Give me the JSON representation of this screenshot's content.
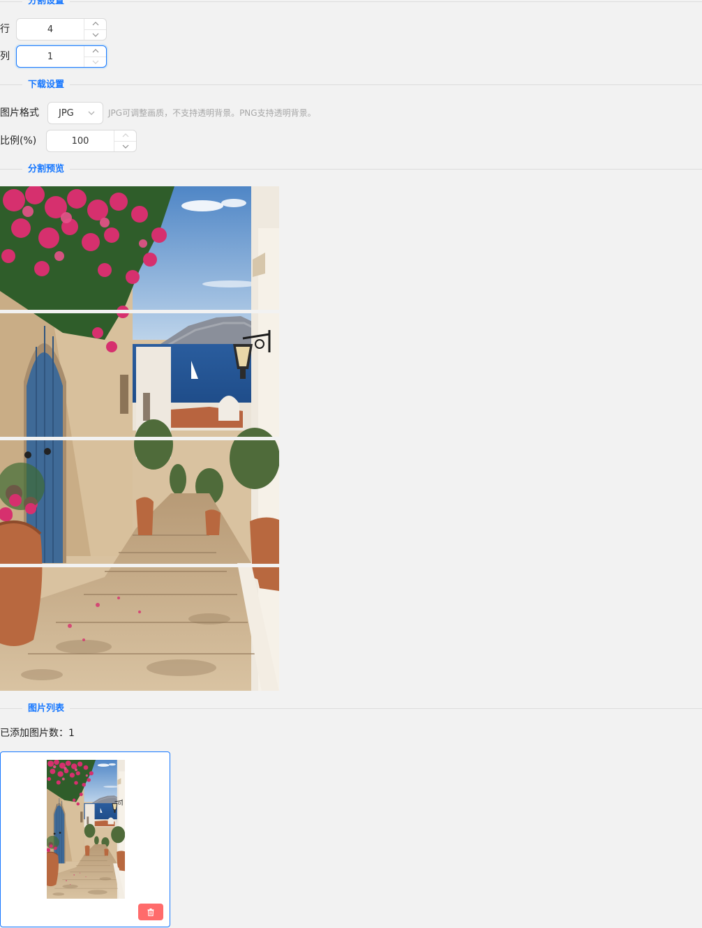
{
  "split_settings": {
    "section_title": "分割设置",
    "rows_label": "行",
    "rows_value": "4",
    "cols_label": "列",
    "cols_value": "1"
  },
  "download_settings": {
    "section_title": "下载设置",
    "format_label": "图片格式",
    "format_value": "JPG",
    "format_hint": "JPG可调整画质，不支持透明背景。PNG支持透明背景。",
    "scale_label": "比例(%)",
    "scale_value": "100"
  },
  "preview": {
    "section_title": "分割预览"
  },
  "image_list": {
    "section_title": "图片列表",
    "count_text": "已添加图片数：1"
  },
  "icons": {
    "stepper_up": "chevron-up-icon",
    "stepper_down": "chevron-down-icon",
    "select_arrow": "chevron-down-icon",
    "delete": "trash-icon"
  },
  "colors": {
    "accent": "#1677ff",
    "danger": "#ff6b6b",
    "background": "#f2f2f2"
  }
}
